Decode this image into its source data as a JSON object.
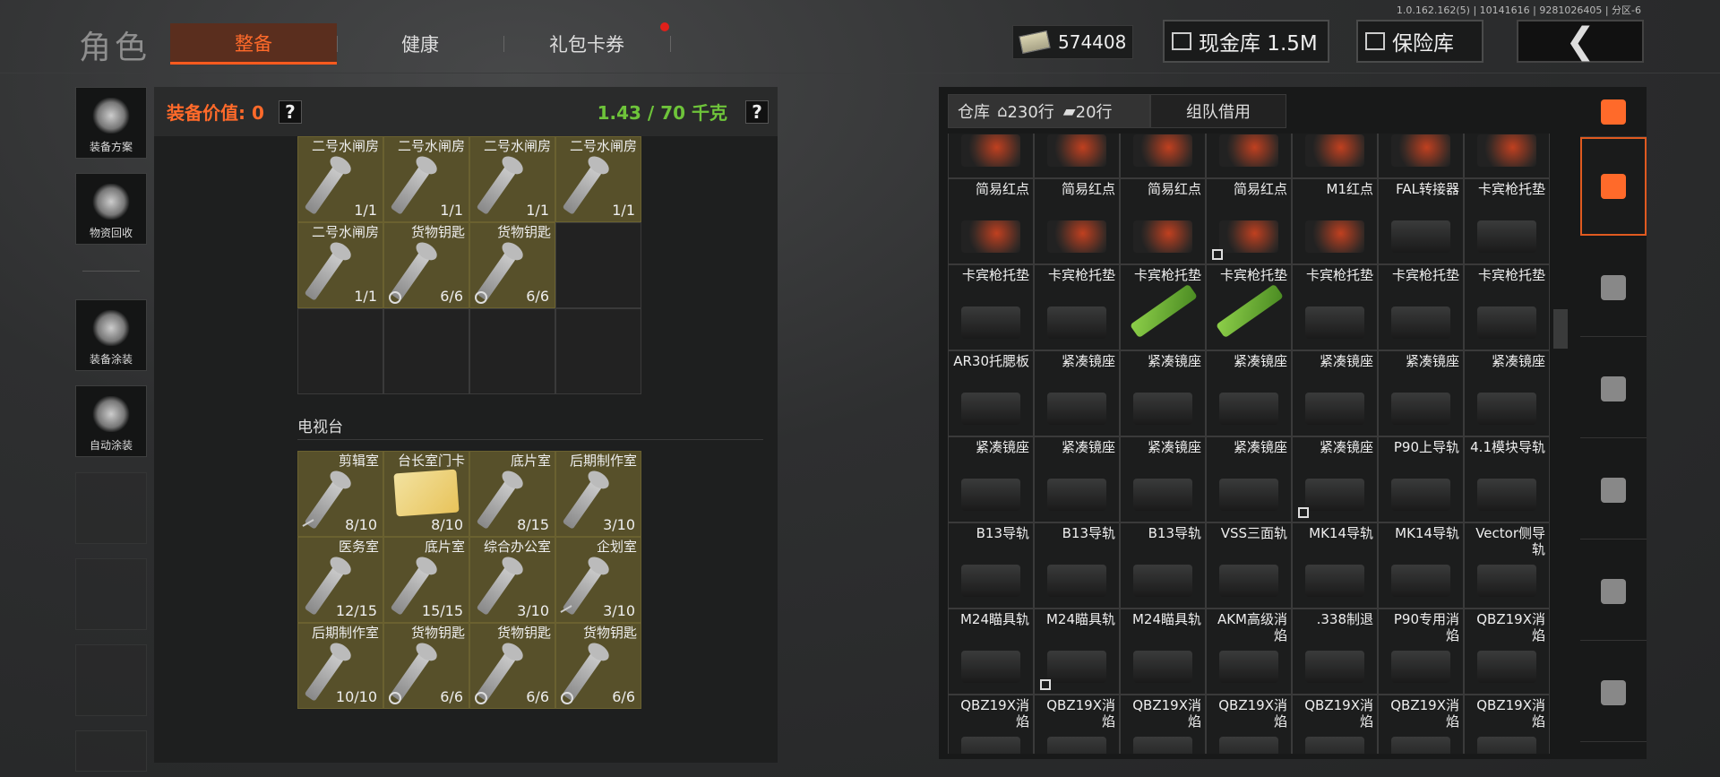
{
  "version_info": "1.0.162.162(5) | 10141616 | 9281026405 | 分区-6",
  "header": {
    "title": "角色",
    "tabs": [
      {
        "label": "整备",
        "active": true
      },
      {
        "label": "健康"
      },
      {
        "label": "礼包卡券",
        "notification": true
      }
    ],
    "money": "574408",
    "cash_vault_label": "现金库 1.5M",
    "safe_label": "保险库",
    "back_icon": "chevron-left-icon"
  },
  "sidebar": {
    "items": [
      {
        "label": "装备方案",
        "icon": "helmet-gear-icon"
      },
      {
        "label": "物资回收",
        "icon": "recycle-bag-icon"
      },
      {
        "label": "装备涂装",
        "icon": "helmet-paint-icon"
      },
      {
        "label": "自动涂装",
        "icon": "brush-gear-icon"
      }
    ]
  },
  "left_panel": {
    "equip_value_label": "装备价值: 0",
    "help": "?",
    "weight": "1.43 / 70 千克",
    "keys_grid_top": [
      {
        "name": "二号水闸房",
        "count": "1/1"
      },
      {
        "name": "二号水闸房",
        "count": "1/1"
      },
      {
        "name": "二号水闸房",
        "count": "1/1"
      },
      {
        "name": "二号水闸房",
        "count": "1/1"
      },
      {
        "name": "二号水闸房",
        "count": "1/1"
      },
      {
        "name": "货物钥匙",
        "count": "6/6",
        "timed": true
      },
      {
        "name": "货物钥匙",
        "count": "6/6",
        "timed": true
      }
    ],
    "section_tv": "电视台",
    "keys_grid_tv": [
      {
        "name": "剪辑室",
        "count": "8/10",
        "broken": true
      },
      {
        "name": "台长室门卡",
        "count": "8/10",
        "card": true
      },
      {
        "name": "底片室",
        "count": "8/15"
      },
      {
        "name": "后期制作室",
        "count": "3/10"
      },
      {
        "name": "医务室",
        "count": "12/15"
      },
      {
        "name": "底片室",
        "count": "15/15"
      },
      {
        "name": "综合办公室",
        "count": "3/10"
      },
      {
        "name": "企划室",
        "count": "3/10",
        "broken": true
      },
      {
        "name": "后期制作室",
        "count": "10/10"
      },
      {
        "name": "货物钥匙",
        "count": "6/6",
        "timed": true
      },
      {
        "name": "货物钥匙",
        "count": "6/6",
        "timed": true
      },
      {
        "name": "货物钥匙",
        "count": "6/6",
        "timed": true
      }
    ]
  },
  "right_panel": {
    "tabs": [
      {
        "label": "仓库",
        "active": true
      },
      {
        "label": "230行"
      },
      {
        "label": "20行"
      },
      {
        "label": "组队借用"
      }
    ],
    "items": [
      {
        "name": "",
        "kind": "red"
      },
      {
        "name": "",
        "kind": "red"
      },
      {
        "name": "",
        "kind": "red"
      },
      {
        "name": "",
        "kind": "red"
      },
      {
        "name": "",
        "kind": "red"
      },
      {
        "name": "",
        "kind": "red"
      },
      {
        "name": "",
        "kind": "red"
      },
      {
        "name": "简易红点",
        "kind": "red"
      },
      {
        "name": "简易红点",
        "kind": "red"
      },
      {
        "name": "简易红点",
        "kind": "red"
      },
      {
        "name": "简易红点",
        "kind": "red",
        "mark": true
      },
      {
        "name": "M1红点",
        "kind": "red"
      },
      {
        "name": "FAL转接器"
      },
      {
        "name": "卡宾枪托垫"
      },
      {
        "name": "卡宾枪托垫"
      },
      {
        "name": "卡宾枪托垫"
      },
      {
        "name": "卡宾枪托垫",
        "kind": "green"
      },
      {
        "name": "卡宾枪托垫",
        "kind": "green"
      },
      {
        "name": "卡宾枪托垫"
      },
      {
        "name": "卡宾枪托垫"
      },
      {
        "name": "卡宾枪托垫"
      },
      {
        "name": "AR30托腮板"
      },
      {
        "name": "紧凑镜座"
      },
      {
        "name": "紧凑镜座"
      },
      {
        "name": "紧凑镜座"
      },
      {
        "name": "紧凑镜座"
      },
      {
        "name": "紧凑镜座"
      },
      {
        "name": "紧凑镜座"
      },
      {
        "name": "紧凑镜座"
      },
      {
        "name": "紧凑镜座"
      },
      {
        "name": "紧凑镜座"
      },
      {
        "name": "紧凑镜座"
      },
      {
        "name": "紧凑镜座",
        "mark": true
      },
      {
        "name": "P90上导轨"
      },
      {
        "name": "4.1模块导轨"
      },
      {
        "name": "B13导轨"
      },
      {
        "name": "B13导轨"
      },
      {
        "name": "B13导轨"
      },
      {
        "name": "VSS三面轨"
      },
      {
        "name": "MK14导轨"
      },
      {
        "name": "MK14导轨"
      },
      {
        "name": "Vector侧导轨"
      },
      {
        "name": "M24瞄具轨"
      },
      {
        "name": "M24瞄具轨",
        "mark": true
      },
      {
        "name": "M24瞄具轨"
      },
      {
        "name": "AKM高级消焰"
      },
      {
        "name": ".338制退"
      },
      {
        "name": "P90专用消焰"
      },
      {
        "name": "QBZ19X消焰"
      },
      {
        "name": "QBZ19X消焰"
      },
      {
        "name": "QBZ19X消焰"
      },
      {
        "name": "QBZ19X消焰"
      },
      {
        "name": "QBZ19X消焰"
      },
      {
        "name": "QBZ19X消焰"
      },
      {
        "name": "QBZ19X消焰"
      },
      {
        "name": "QBZ19X消焰"
      }
    ]
  },
  "vertical_tabs": [
    {
      "icon": "sort-layers-icon"
    },
    {
      "icon": "layers-icon",
      "active": true
    },
    {
      "icon": "vest-icon"
    },
    {
      "icon": "rifle-icon"
    },
    {
      "icon": "magazine-icon"
    },
    {
      "icon": "ammo-icon"
    },
    {
      "icon": "scope-icon"
    }
  ],
  "colors": {
    "accent": "#ff6a2a",
    "weight": "#6ec43a",
    "key_cell": "#57502a"
  }
}
